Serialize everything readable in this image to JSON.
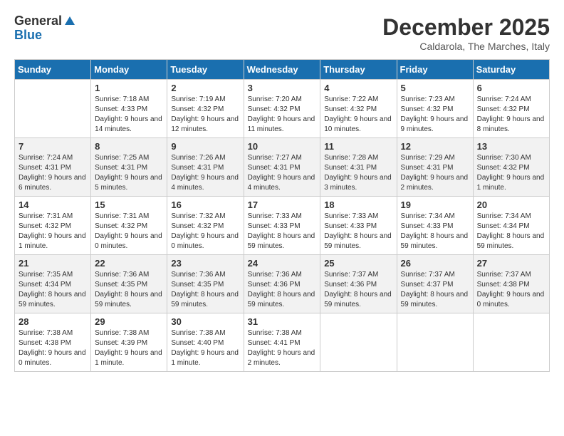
{
  "header": {
    "logo_general": "General",
    "logo_blue": "Blue",
    "month_title": "December 2025",
    "location": "Caldarola, The Marches, Italy"
  },
  "weekdays": [
    "Sunday",
    "Monday",
    "Tuesday",
    "Wednesday",
    "Thursday",
    "Friday",
    "Saturday"
  ],
  "weeks": [
    [
      {
        "day": "",
        "sunrise": "",
        "sunset": "",
        "daylight": ""
      },
      {
        "day": "1",
        "sunrise": "Sunrise: 7:18 AM",
        "sunset": "Sunset: 4:33 PM",
        "daylight": "Daylight: 9 hours and 14 minutes."
      },
      {
        "day": "2",
        "sunrise": "Sunrise: 7:19 AM",
        "sunset": "Sunset: 4:32 PM",
        "daylight": "Daylight: 9 hours and 12 minutes."
      },
      {
        "day": "3",
        "sunrise": "Sunrise: 7:20 AM",
        "sunset": "Sunset: 4:32 PM",
        "daylight": "Daylight: 9 hours and 11 minutes."
      },
      {
        "day": "4",
        "sunrise": "Sunrise: 7:22 AM",
        "sunset": "Sunset: 4:32 PM",
        "daylight": "Daylight: 9 hours and 10 minutes."
      },
      {
        "day": "5",
        "sunrise": "Sunrise: 7:23 AM",
        "sunset": "Sunset: 4:32 PM",
        "daylight": "Daylight: 9 hours and 9 minutes."
      },
      {
        "day": "6",
        "sunrise": "Sunrise: 7:24 AM",
        "sunset": "Sunset: 4:32 PM",
        "daylight": "Daylight: 9 hours and 8 minutes."
      }
    ],
    [
      {
        "day": "7",
        "sunrise": "Sunrise: 7:24 AM",
        "sunset": "Sunset: 4:31 PM",
        "daylight": "Daylight: 9 hours and 6 minutes."
      },
      {
        "day": "8",
        "sunrise": "Sunrise: 7:25 AM",
        "sunset": "Sunset: 4:31 PM",
        "daylight": "Daylight: 9 hours and 5 minutes."
      },
      {
        "day": "9",
        "sunrise": "Sunrise: 7:26 AM",
        "sunset": "Sunset: 4:31 PM",
        "daylight": "Daylight: 9 hours and 4 minutes."
      },
      {
        "day": "10",
        "sunrise": "Sunrise: 7:27 AM",
        "sunset": "Sunset: 4:31 PM",
        "daylight": "Daylight: 9 hours and 4 minutes."
      },
      {
        "day": "11",
        "sunrise": "Sunrise: 7:28 AM",
        "sunset": "Sunset: 4:31 PM",
        "daylight": "Daylight: 9 hours and 3 minutes."
      },
      {
        "day": "12",
        "sunrise": "Sunrise: 7:29 AM",
        "sunset": "Sunset: 4:31 PM",
        "daylight": "Daylight: 9 hours and 2 minutes."
      },
      {
        "day": "13",
        "sunrise": "Sunrise: 7:30 AM",
        "sunset": "Sunset: 4:32 PM",
        "daylight": "Daylight: 9 hours and 1 minute."
      }
    ],
    [
      {
        "day": "14",
        "sunrise": "Sunrise: 7:31 AM",
        "sunset": "Sunset: 4:32 PM",
        "daylight": "Daylight: 9 hours and 1 minute."
      },
      {
        "day": "15",
        "sunrise": "Sunrise: 7:31 AM",
        "sunset": "Sunset: 4:32 PM",
        "daylight": "Daylight: 9 hours and 0 minutes."
      },
      {
        "day": "16",
        "sunrise": "Sunrise: 7:32 AM",
        "sunset": "Sunset: 4:32 PM",
        "daylight": "Daylight: 9 hours and 0 minutes."
      },
      {
        "day": "17",
        "sunrise": "Sunrise: 7:33 AM",
        "sunset": "Sunset: 4:33 PM",
        "daylight": "Daylight: 8 hours and 59 minutes."
      },
      {
        "day": "18",
        "sunrise": "Sunrise: 7:33 AM",
        "sunset": "Sunset: 4:33 PM",
        "daylight": "Daylight: 8 hours and 59 minutes."
      },
      {
        "day": "19",
        "sunrise": "Sunrise: 7:34 AM",
        "sunset": "Sunset: 4:33 PM",
        "daylight": "Daylight: 8 hours and 59 minutes."
      },
      {
        "day": "20",
        "sunrise": "Sunrise: 7:34 AM",
        "sunset": "Sunset: 4:34 PM",
        "daylight": "Daylight: 8 hours and 59 minutes."
      }
    ],
    [
      {
        "day": "21",
        "sunrise": "Sunrise: 7:35 AM",
        "sunset": "Sunset: 4:34 PM",
        "daylight": "Daylight: 8 hours and 59 minutes."
      },
      {
        "day": "22",
        "sunrise": "Sunrise: 7:36 AM",
        "sunset": "Sunset: 4:35 PM",
        "daylight": "Daylight: 8 hours and 59 minutes."
      },
      {
        "day": "23",
        "sunrise": "Sunrise: 7:36 AM",
        "sunset": "Sunset: 4:35 PM",
        "daylight": "Daylight: 8 hours and 59 minutes."
      },
      {
        "day": "24",
        "sunrise": "Sunrise: 7:36 AM",
        "sunset": "Sunset: 4:36 PM",
        "daylight": "Daylight: 8 hours and 59 minutes."
      },
      {
        "day": "25",
        "sunrise": "Sunrise: 7:37 AM",
        "sunset": "Sunset: 4:36 PM",
        "daylight": "Daylight: 8 hours and 59 minutes."
      },
      {
        "day": "26",
        "sunrise": "Sunrise: 7:37 AM",
        "sunset": "Sunset: 4:37 PM",
        "daylight": "Daylight: 8 hours and 59 minutes."
      },
      {
        "day": "27",
        "sunrise": "Sunrise: 7:37 AM",
        "sunset": "Sunset: 4:38 PM",
        "daylight": "Daylight: 9 hours and 0 minutes."
      }
    ],
    [
      {
        "day": "28",
        "sunrise": "Sunrise: 7:38 AM",
        "sunset": "Sunset: 4:38 PM",
        "daylight": "Daylight: 9 hours and 0 minutes."
      },
      {
        "day": "29",
        "sunrise": "Sunrise: 7:38 AM",
        "sunset": "Sunset: 4:39 PM",
        "daylight": "Daylight: 9 hours and 1 minute."
      },
      {
        "day": "30",
        "sunrise": "Sunrise: 7:38 AM",
        "sunset": "Sunset: 4:40 PM",
        "daylight": "Daylight: 9 hours and 1 minute."
      },
      {
        "day": "31",
        "sunrise": "Sunrise: 7:38 AM",
        "sunset": "Sunset: 4:41 PM",
        "daylight": "Daylight: 9 hours and 2 minutes."
      },
      {
        "day": "",
        "sunrise": "",
        "sunset": "",
        "daylight": ""
      },
      {
        "day": "",
        "sunrise": "",
        "sunset": "",
        "daylight": ""
      },
      {
        "day": "",
        "sunrise": "",
        "sunset": "",
        "daylight": ""
      }
    ]
  ]
}
